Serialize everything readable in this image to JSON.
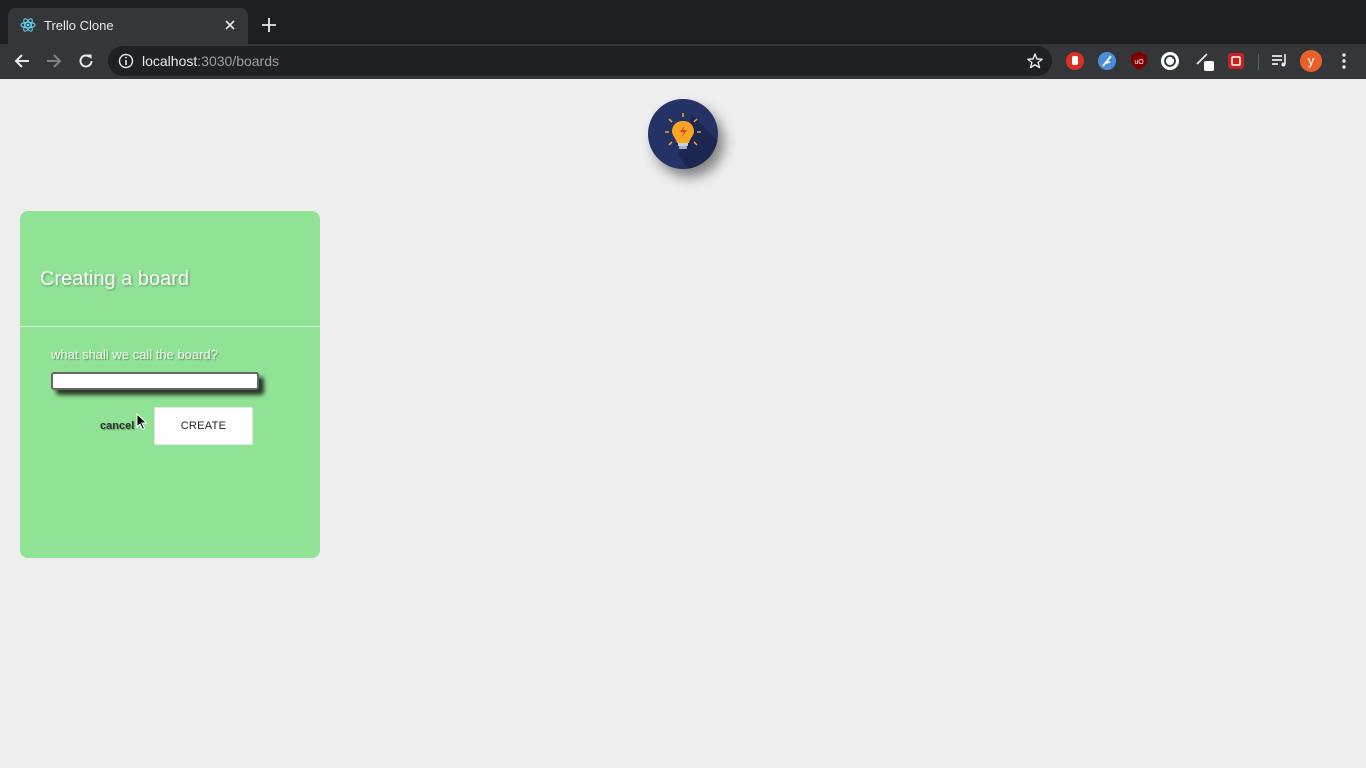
{
  "browser": {
    "tab_title": "Trello Clone",
    "url_host": "localhost",
    "url_rest": ":3030/boards",
    "avatar_letter": "y"
  },
  "icons": {
    "tab_favicon": "react-icon",
    "tab_close": "close-icon",
    "new_tab": "plus-icon",
    "back": "arrow-left-icon",
    "forward": "arrow-right-icon",
    "reload": "reload-icon",
    "site_info": "info-icon",
    "bookmark": "star-icon",
    "logo": "lightbulb-icon",
    "menu": "kebab-menu-icon"
  },
  "colors": {
    "card_background": "#90e295",
    "logo_background": "#253266",
    "avatar_background": "#e8612c"
  },
  "board_form": {
    "title": "Creating a board",
    "name_label": "what shall we call the board?",
    "name_value": "",
    "cancel_label": "cancel",
    "create_label": "CREATE"
  }
}
